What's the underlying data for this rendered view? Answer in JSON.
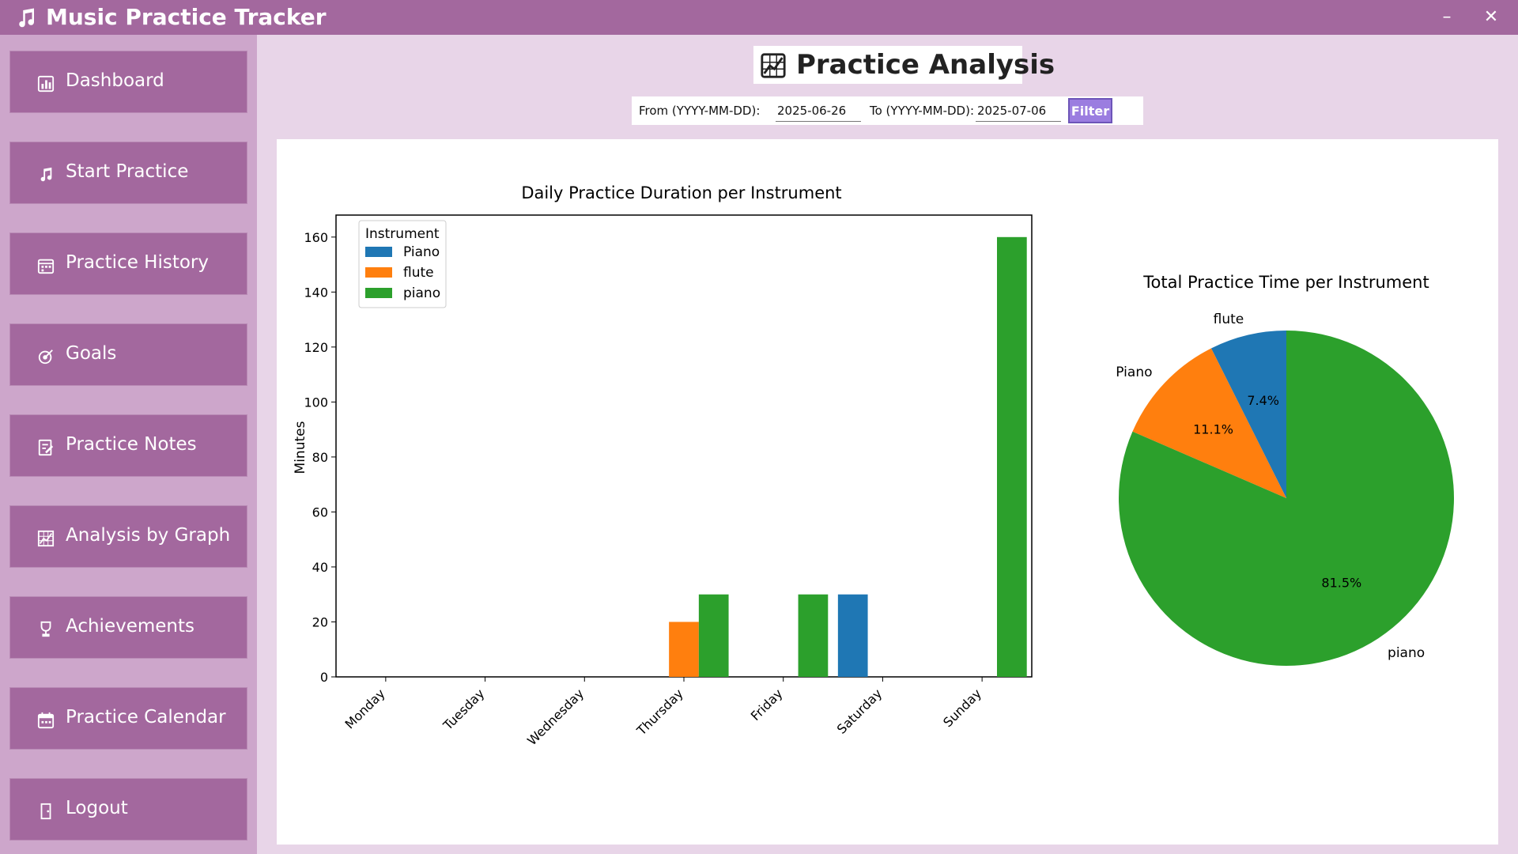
{
  "window": {
    "title": "Music Practice Tracker",
    "minimize_glyph": "–",
    "close_glyph": "✕"
  },
  "sidebar": {
    "items": [
      {
        "label": "Dashboard",
        "icon": "bar-chart-icon"
      },
      {
        "label": "Start Practice",
        "icon": "music-note-icon"
      },
      {
        "label": "Practice History",
        "icon": "calendar-grid-icon"
      },
      {
        "label": "Goals",
        "icon": "target-icon"
      },
      {
        "label": "Practice Notes",
        "icon": "notepad-icon"
      },
      {
        "label": "Analysis by Graph",
        "icon": "chart-icon"
      },
      {
        "label": "Achievements",
        "icon": "trophy-icon"
      },
      {
        "label": "Practice Calendar",
        "icon": "calendar-icon"
      },
      {
        "label": "Logout",
        "icon": "door-icon"
      }
    ]
  },
  "page": {
    "title": "Practice Analysis"
  },
  "filter": {
    "from_label": "From (YYYY-MM-DD):",
    "from_value": "2025-06-26",
    "to_label": "To (YYYY-MM-DD):",
    "to_value": "2025-07-06",
    "button_label": "Filter"
  },
  "colors": {
    "accent": "#a3689e",
    "sidebar_bg": "#cda6cb",
    "filter_button": "#9b7de0",
    "series_piano_cap": "#1f77b4",
    "series_flute": "#ff7f0e",
    "series_piano": "#2ca02c"
  },
  "chart_data": [
    {
      "type": "bar",
      "title": "Daily Practice Duration per Instrument",
      "xlabel": "",
      "ylabel": "Minutes",
      "categories": [
        "Monday",
        "Tuesday",
        "Wednesday",
        "Thursday",
        "Friday",
        "Saturday",
        "Sunday"
      ],
      "series": [
        {
          "name": "Piano",
          "color": "#1f77b4",
          "values": [
            0,
            0,
            0,
            0,
            0,
            30,
            0
          ]
        },
        {
          "name": "flute",
          "color": "#ff7f0e",
          "values": [
            0,
            0,
            0,
            20,
            0,
            0,
            0
          ]
        },
        {
          "name": "piano",
          "color": "#2ca02c",
          "values": [
            0,
            0,
            0,
            30,
            30,
            0,
            160
          ]
        }
      ],
      "ylim": [
        0,
        168
      ],
      "yticks": [
        0,
        20,
        40,
        60,
        80,
        100,
        120,
        140,
        160
      ],
      "legend": {
        "title": "Instrument",
        "placement": "top-left"
      },
      "grid": false
    },
    {
      "type": "pie",
      "title": "Total Practice Time per Instrument",
      "slices": [
        {
          "label": "flute",
          "value": 7.4,
          "pct_label": "7.4%",
          "color": "#1f77b4"
        },
        {
          "label": "Piano",
          "value": 11.1,
          "pct_label": "11.1%",
          "color": "#ff7f0e"
        },
        {
          "label": "piano",
          "value": 81.5,
          "pct_label": "81.5%",
          "color": "#2ca02c"
        }
      ],
      "start_angle_deg": 90,
      "counterclockwise": true
    }
  ]
}
